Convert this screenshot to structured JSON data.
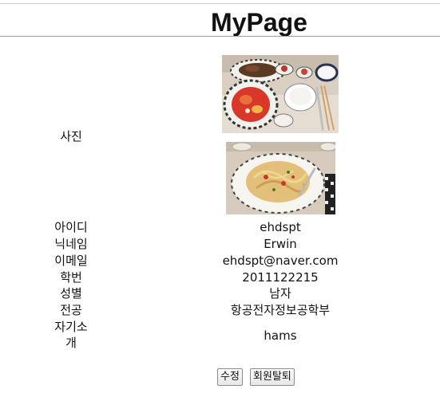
{
  "page": {
    "title": "MyPage"
  },
  "profile": {
    "photo_label": "사진",
    "photos": [
      {
        "icon": "food-photo-icon",
        "subject": "steak-and-salad-meal"
      },
      {
        "icon": "food-photo-icon",
        "subject": "pasta-dish"
      }
    ],
    "fields": {
      "id": {
        "label": "아이디",
        "value": "ehdspt"
      },
      "nickname": {
        "label": "닉네임",
        "value": "Erwin"
      },
      "email": {
        "label": "이메일",
        "value": "ehdspt@naver.com"
      },
      "student_id": {
        "label": "학번",
        "value": "2011122215"
      },
      "gender": {
        "label": "성별",
        "value": "남자"
      },
      "major": {
        "label": "전공",
        "value": "항공전자정보공학부"
      },
      "intro": {
        "label_line1": "자기소",
        "label_line2": "개",
        "value": "hams"
      }
    }
  },
  "actions": {
    "edit_label": "수정",
    "withdraw_label": "회원탈퇴"
  }
}
